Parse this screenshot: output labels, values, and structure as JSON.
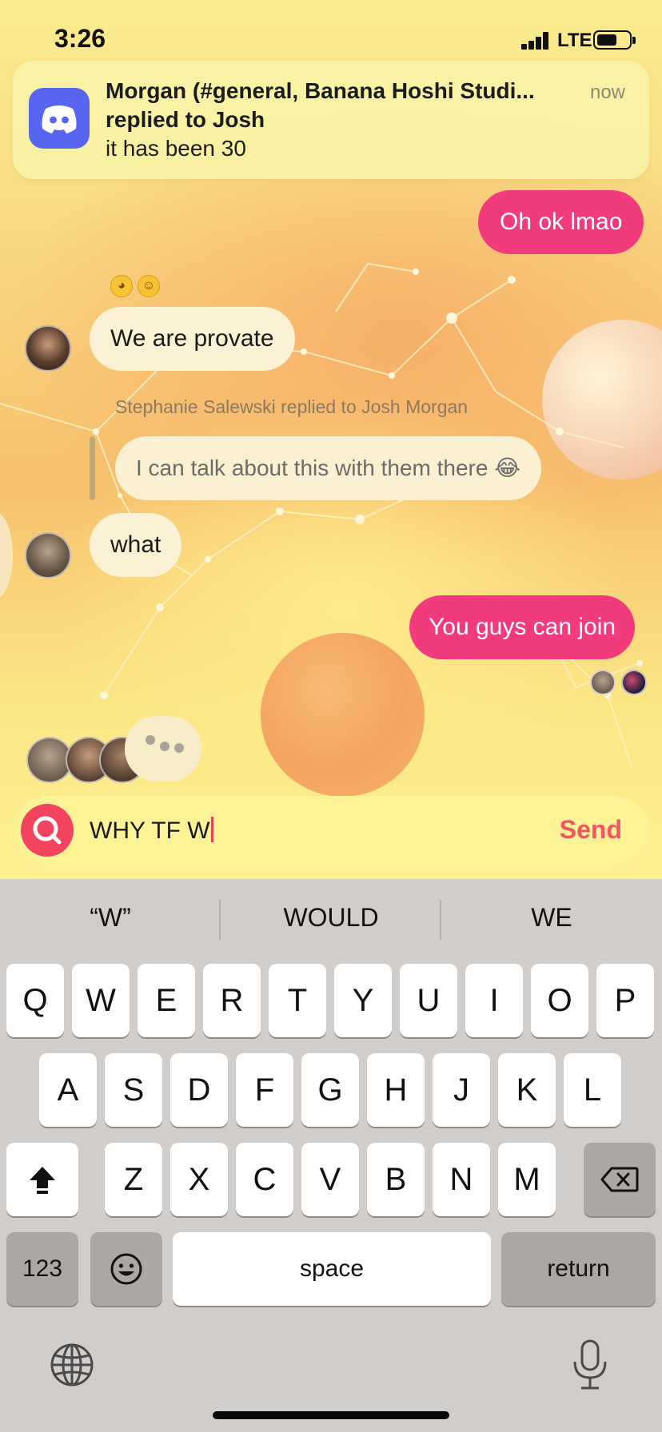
{
  "status_bar": {
    "time": "3:26",
    "network": "LTE"
  },
  "notification": {
    "app_icon": "discord-icon",
    "title": "Morgan (#general, Banana Hoshi Studi...",
    "subtitle": "replied to Josh",
    "body": "it has been 30",
    "time": "now"
  },
  "messages": [
    {
      "from": "me",
      "text": "Oh ok lmao"
    },
    {
      "from": "other",
      "text": "We are provate",
      "reactions": [
        "upside-down-face-emoji",
        "slightly-smiling-face-emoji"
      ]
    },
    {
      "from": "other",
      "reply_meta": "Stephanie Salewski replied to Josh Morgan",
      "text": "I can talk about this with them there 😂"
    },
    {
      "from": "other",
      "text": "what"
    },
    {
      "from": "me",
      "text": "You guys can join"
    }
  ],
  "composer": {
    "left_icon": "search-icon",
    "value": "WHY TF W",
    "send_label": "Send"
  },
  "keyboard": {
    "suggestions": [
      "“W”",
      "WOULD",
      "WE"
    ],
    "row1": [
      "Q",
      "W",
      "E",
      "R",
      "T",
      "Y",
      "U",
      "I",
      "O",
      "P"
    ],
    "row2": [
      "A",
      "S",
      "D",
      "F",
      "G",
      "H",
      "J",
      "K",
      "L"
    ],
    "row3": [
      "Z",
      "X",
      "C",
      "V",
      "B",
      "N",
      "M"
    ],
    "numbers_label": "123",
    "space_label": "space",
    "return_label": "return"
  },
  "colors": {
    "my_bubble": "#f23b7c",
    "their_bubble": "#fbf1d4",
    "send": "#f15563",
    "discord": "#5865f2"
  }
}
